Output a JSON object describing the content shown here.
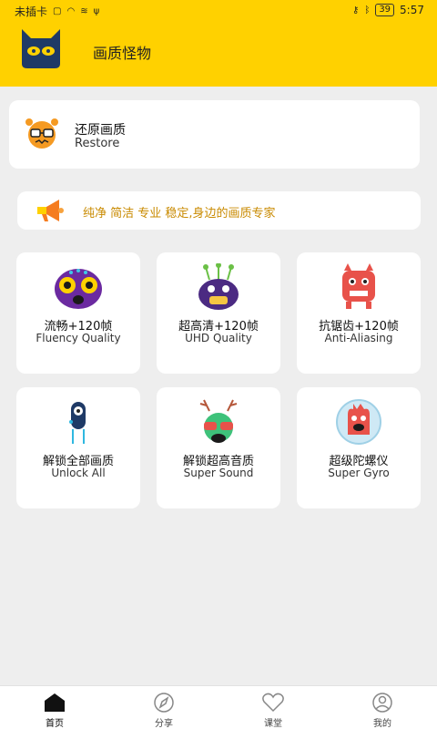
{
  "status": {
    "carrier": "未插卡",
    "time": "5:57",
    "battery": "39"
  },
  "app": {
    "title": "画质怪物"
  },
  "restore": {
    "title": "还原画质",
    "subtitle": "Restore"
  },
  "slogan": {
    "text": "纯净 简洁 专业 稳定,身边的画质专家"
  },
  "tiles": [
    {
      "cn": "流畅+120帧",
      "en": "Fluency Quality"
    },
    {
      "cn": "超高清+120帧",
      "en": "UHD Quality"
    },
    {
      "cn": "抗锯齿+120帧",
      "en": "Anti-Aliasing"
    },
    {
      "cn": "解锁全部画质",
      "en": "Unlock All"
    },
    {
      "cn": "解锁超高音质",
      "en": "Super Sound"
    },
    {
      "cn": "超级陀螺仪",
      "en": "Super Gyro"
    }
  ],
  "nav": [
    {
      "label": "首页"
    },
    {
      "label": "分享"
    },
    {
      "label": "课堂"
    },
    {
      "label": "我的"
    }
  ]
}
